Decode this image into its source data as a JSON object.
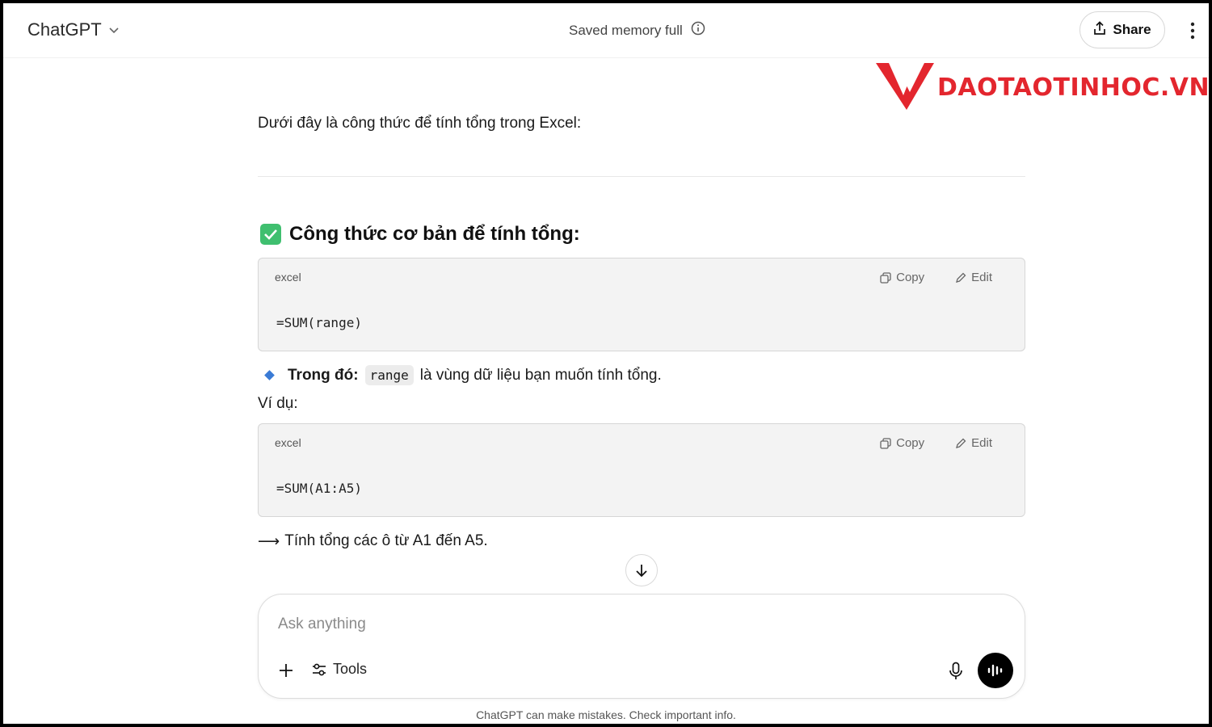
{
  "header": {
    "model_name": "ChatGPT",
    "memory_status": "Saved memory full",
    "share_label": "Share"
  },
  "logo": {
    "text": "DAOTAOTINHOC.VN",
    "color": "#e3262e"
  },
  "message": {
    "intro": "Dưới đây là công thức để tính tổng trong Excel:",
    "heading": "Công thức cơ bản để tính tổng:",
    "code_blocks": [
      {
        "lang": "excel",
        "copy_label": "Copy",
        "edit_label": "Edit",
        "code": "=SUM(range)"
      },
      {
        "lang": "excel",
        "copy_label": "Copy",
        "edit_label": "Edit",
        "code": "=SUM(A1:A5)"
      }
    ],
    "bullet_strong": "Trong đó:",
    "bullet_code": "range",
    "bullet_rest": "là vùng dữ liệu bạn muốn tính tổng.",
    "example_label": "Ví dụ:",
    "result_arrow": "⟶",
    "result_text": "Tính tổng các ô từ A1 đến A5."
  },
  "composer": {
    "placeholder": "Ask anything",
    "tools_label": "Tools"
  },
  "footer": {
    "disclaimer": "ChatGPT can make mistakes. Check important info."
  },
  "colors": {
    "accent_check": "#3fbf6f",
    "bullet_diamond": "#3a7bd5"
  }
}
